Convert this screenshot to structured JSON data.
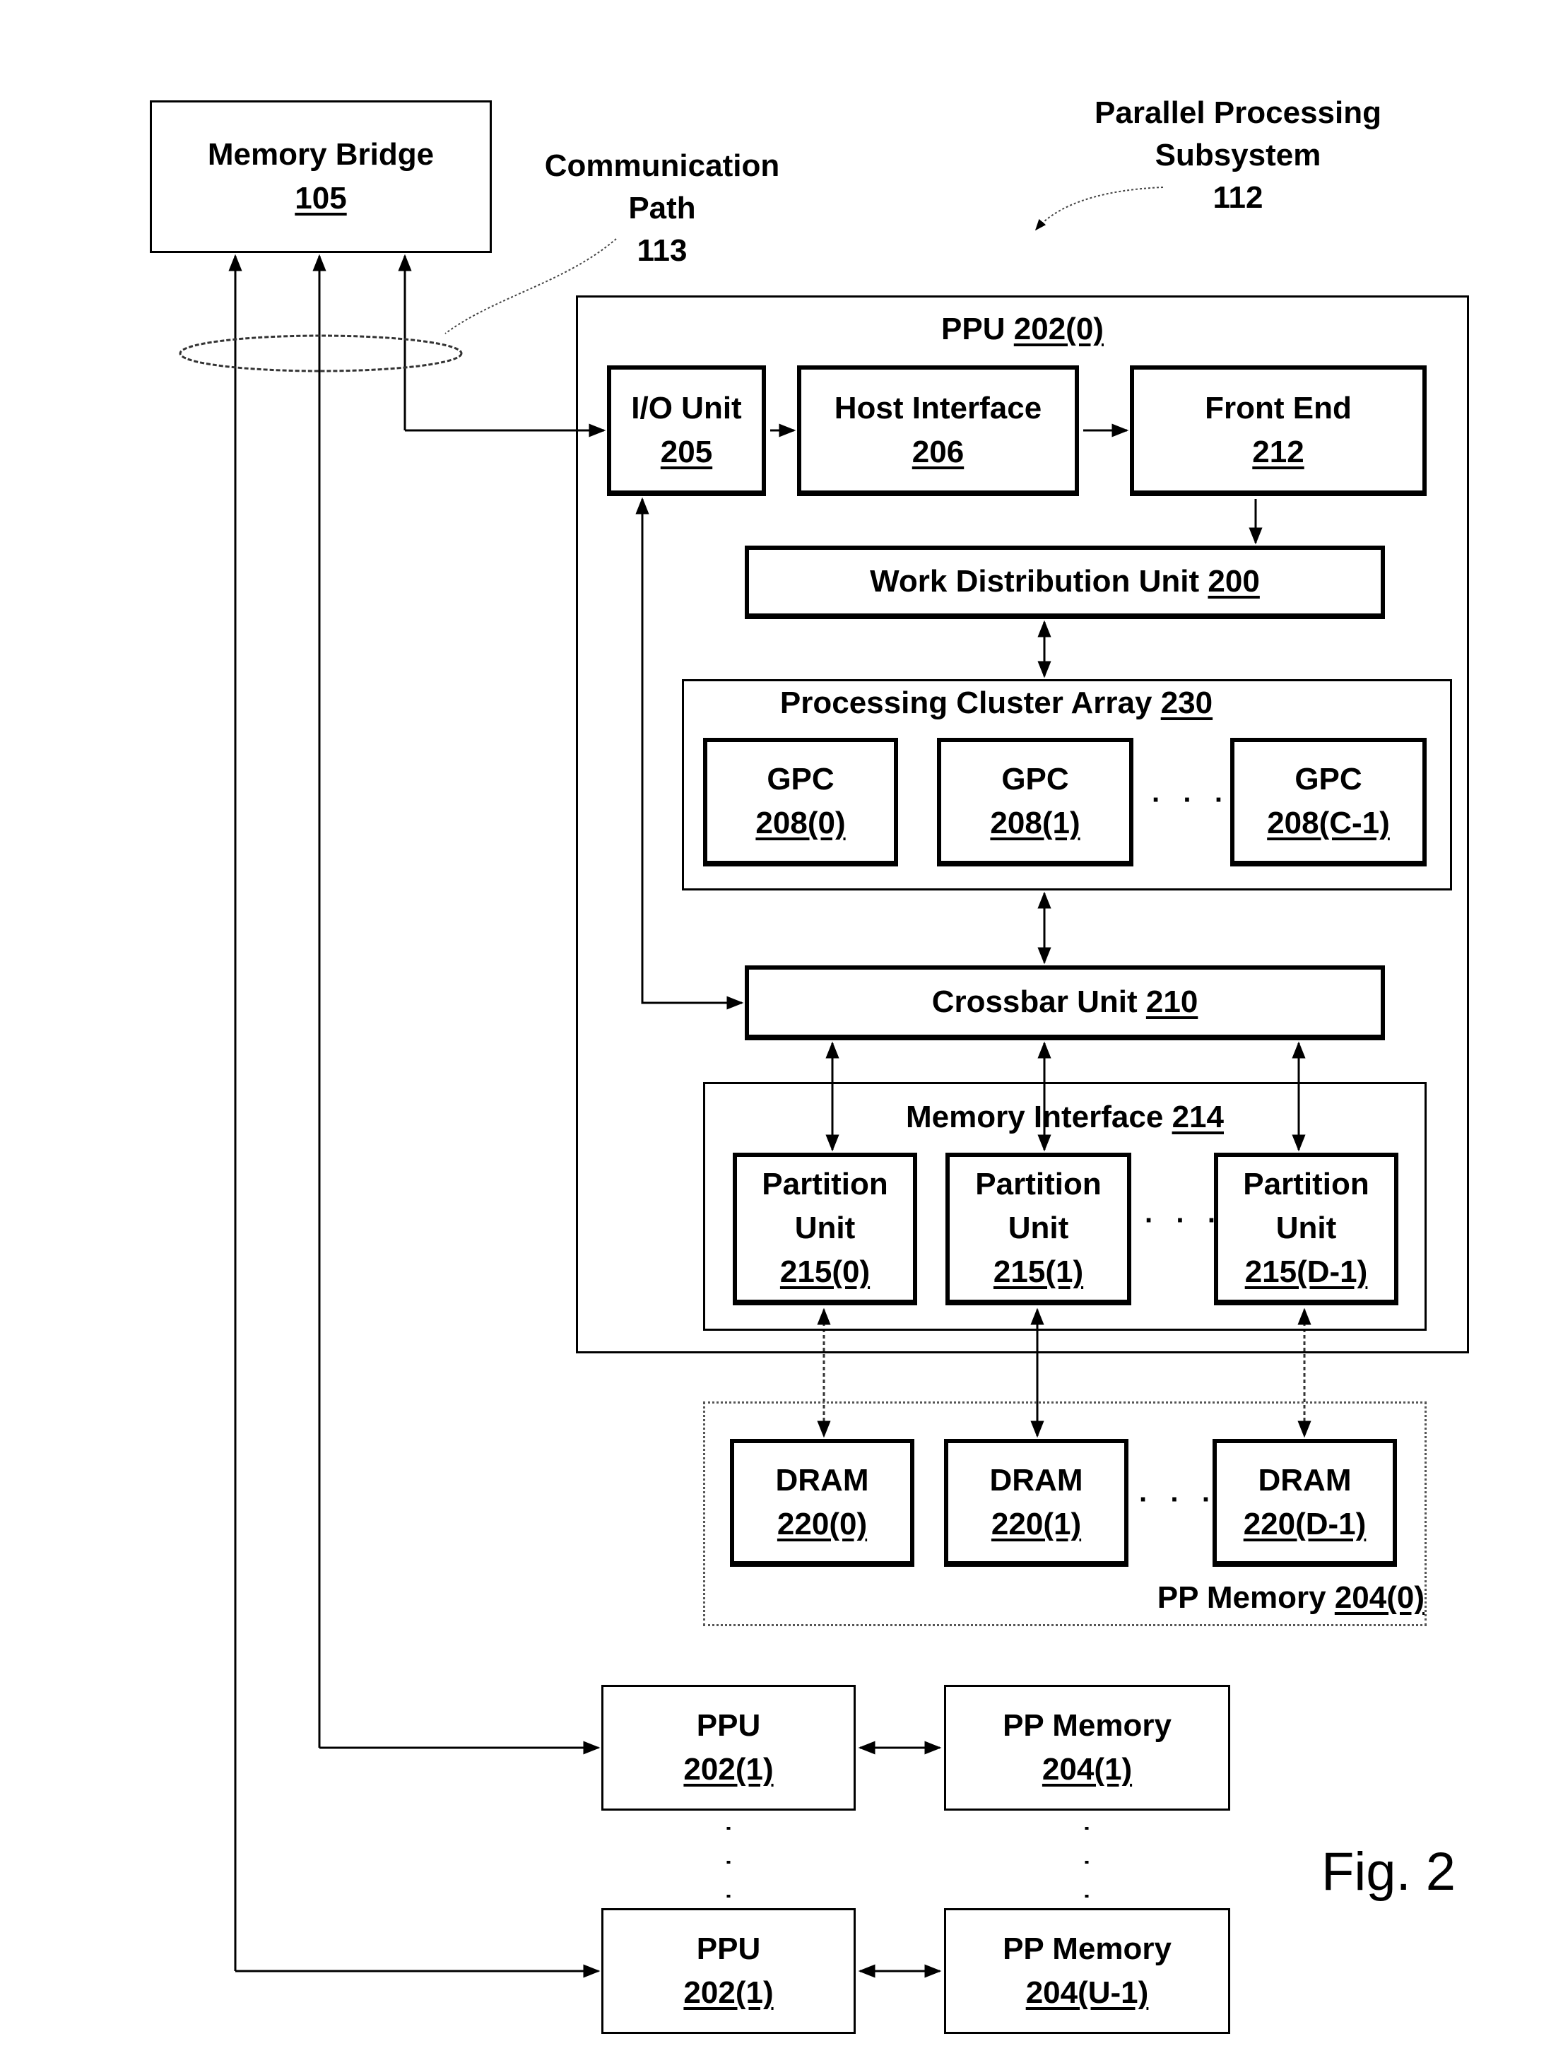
{
  "figure_label": "Fig. 2",
  "memory_bridge": {
    "name": "Memory Bridge",
    "ref": "105"
  },
  "communication_path": {
    "line1": "Communication",
    "line2": "Path",
    "ref": "113"
  },
  "subsystem": {
    "line1": "Parallel Processing",
    "line2": "Subsystem",
    "ref": "112"
  },
  "ppu0": {
    "title": "PPU",
    "ref": "202(0)",
    "io_unit": {
      "name": "I/O Unit",
      "ref": "205"
    },
    "host_interface": {
      "name": "Host Interface",
      "ref": "206"
    },
    "front_end": {
      "name": "Front End",
      "ref": "212"
    },
    "work_distribution": {
      "name": "Work Distribution Unit",
      "ref": "200"
    },
    "cluster_array": {
      "name": "Processing Cluster Array",
      "ref": "230",
      "gpcs": [
        {
          "name": "GPC",
          "ref": "208(0)"
        },
        {
          "name": "GPC",
          "ref": "208(1)"
        },
        {
          "name": "GPC",
          "ref": "208(C-1)"
        }
      ],
      "ellipsis": "· · ·"
    },
    "crossbar": {
      "name": "Crossbar Unit",
      "ref": "210"
    },
    "memory_interface": {
      "name": "Memory Interface",
      "ref": "214",
      "partitions": [
        {
          "line1": "Partition",
          "line2": "Unit",
          "ref": "215(0)"
        },
        {
          "line1": "Partition",
          "line2": "Unit",
          "ref": "215(1)"
        },
        {
          "line1": "Partition",
          "line2": "Unit",
          "ref": "215(D-1)"
        }
      ],
      "ellipsis": "· · ·"
    }
  },
  "pp_memory0": {
    "name": "PP Memory",
    "ref": "204(0)",
    "drams": [
      {
        "name": "DRAM",
        "ref": "220(0)"
      },
      {
        "name": "DRAM",
        "ref": "220(1)"
      },
      {
        "name": "DRAM",
        "ref": "220(D-1)"
      }
    ],
    "ellipsis": "· · ·"
  },
  "other_ppus": [
    {
      "ppu_name": "PPU",
      "ppu_ref": "202(1)",
      "mem_name": "PP Memory",
      "mem_ref": "204(1)"
    },
    {
      "ppu_name": "PPU",
      "ppu_ref": "202(1)",
      "mem_name": "PP Memory",
      "mem_ref": "204(U-1)"
    }
  ]
}
